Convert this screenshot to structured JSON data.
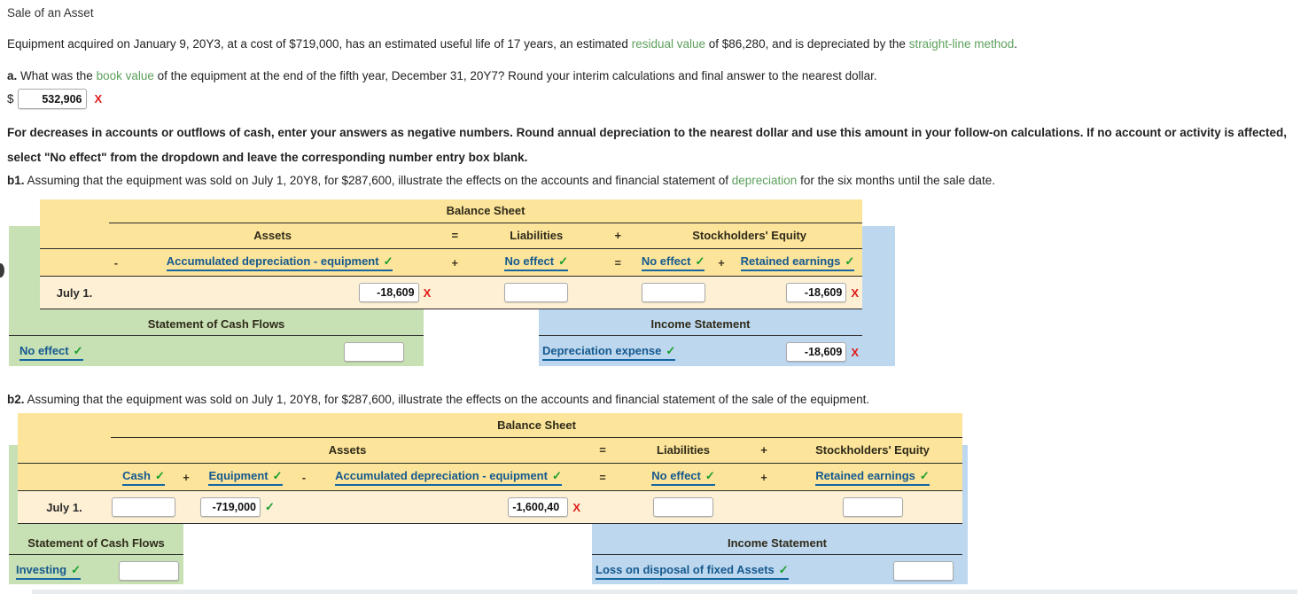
{
  "title": "Sale of an Asset",
  "intro": {
    "part1": "Equipment acquired on January 9, 20Y3, at a cost of $719,000, has an estimated useful life of 17 years, an estimated ",
    "term1": "residual value",
    "part2": " of $86,280, and is depreciated by the ",
    "term2": "straight-line method",
    "part3": "."
  },
  "question_a": {
    "label": "a.",
    "text_before": " What was the ",
    "term": "book value",
    "text_after": " of the equipment at the end of the fifth year, December 31, 20Y7? Round your interim calculations and final answer to the nearest dollar.",
    "currency_symbol": "$",
    "answer_value": "532,906",
    "answer_mark": "X"
  },
  "instructions": "For decreases in accounts or outflows of cash, enter your answers as negative numbers. Round annual depreciation to the nearest dollar and use this amount in your follow-on calculations. If no account or activity is affected, select \"No effect\" from the dropdown and leave the corresponding number entry box blank.",
  "b1": {
    "label": "b1.",
    "text_before": " Assuming that the equipment was sold on July 1, 20Y8, for $287,600, illustrate the effects on the accounts and financial statement of ",
    "term": "depreciation",
    "text_after": " for the six months until the sale date.",
    "balance_sheet_title": "Balance Sheet",
    "group_headers": {
      "assets": "Assets",
      "eq": "=",
      "liabilities": "Liabilities",
      "plus": "+",
      "equity": "Stockholders' Equity"
    },
    "account_headers": [
      {
        "operator": "-",
        "label": "Accumulated depreciation - equipment",
        "check": "✓"
      },
      {
        "operator": "+",
        "label": "No effect",
        "check": "✓"
      },
      {
        "operator": "=",
        "label": "No effect",
        "check": "✓"
      },
      {
        "operator": "+",
        "label": "Retained earnings",
        "check": "✓"
      }
    ],
    "row": {
      "date": "July 1.",
      "cells": [
        {
          "value": "-18,609",
          "mark": "X"
        },
        {
          "value": "",
          "mark": ""
        },
        {
          "value": "",
          "mark": ""
        },
        {
          "value": "-18,609",
          "mark": "X"
        }
      ]
    },
    "cash_flows": {
      "title": "Statement of Cash Flows",
      "account": "No effect",
      "check": "✓",
      "value": "",
      "mark": ""
    },
    "income_statement": {
      "title": "Income Statement",
      "account": "Depreciation expense",
      "check": "✓",
      "value": "-18,609",
      "mark": "X"
    }
  },
  "b2": {
    "label": "b2.",
    "text": " Assuming that the equipment was sold on July 1, 20Y8, for $287,600, illustrate the effects on the accounts and financial statement of the sale of the equipment.",
    "balance_sheet_title": "Balance Sheet",
    "group_headers": {
      "assets": "Assets",
      "eq": "=",
      "liabilities": "Liabilities",
      "plus": "+",
      "equity": "Stockholders' Equity"
    },
    "account_headers": [
      {
        "operator": "",
        "label": "Cash",
        "check": "✓"
      },
      {
        "operator": "+",
        "label": "Equipment",
        "check": "✓"
      },
      {
        "operator": "-",
        "label": "Accumulated depreciation - equipment",
        "check": "✓"
      },
      {
        "operator": "=",
        "label": "No effect",
        "check": "✓"
      },
      {
        "operator": "+",
        "label": "Retained earnings",
        "check": "✓"
      }
    ],
    "row": {
      "date": "July 1.",
      "cells": [
        {
          "value": "",
          "mark": ""
        },
        {
          "value": "-719,000",
          "mark": "✓"
        },
        {
          "value": "-1,600,40",
          "mark": "X"
        },
        {
          "value": "",
          "mark": ""
        },
        {
          "value": "",
          "mark": ""
        }
      ]
    },
    "cash_flows": {
      "title": "Statement of Cash Flows",
      "account": "Investing",
      "check": "✓",
      "value": ""
    },
    "income_statement": {
      "title": "Income Statement",
      "account": "Loss on disposal of fixed Assets",
      "check": "✓",
      "value": ""
    }
  },
  "colors": {
    "header_yellow": "#fce49a",
    "row_yellow": "#fdf0d4",
    "green_panel": "#c7e0b4",
    "blue_panel": "#bdd7ee",
    "link_blue": "#15598f",
    "check_green": "#1a9e2e",
    "error_red": "#e01b1b",
    "term_green": "#5ca05c"
  }
}
